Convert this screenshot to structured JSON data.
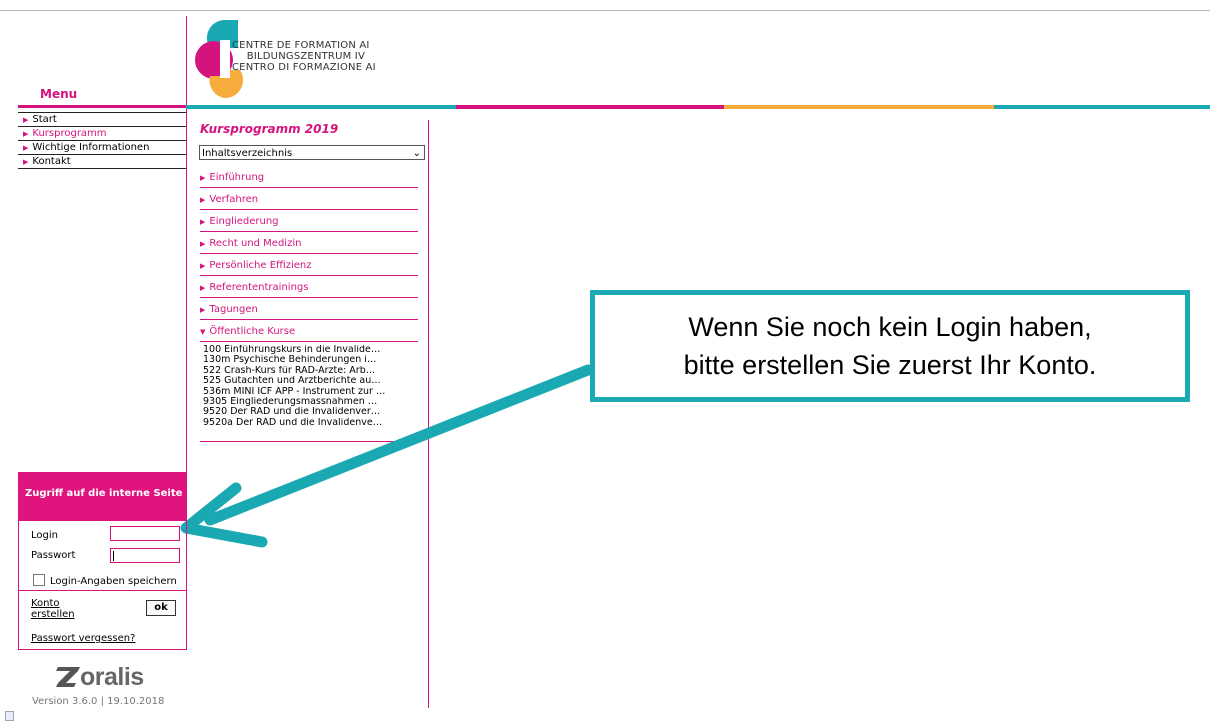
{
  "menu": {
    "title": "Menu",
    "items": [
      {
        "label": "Start"
      },
      {
        "label": "Kursprogramm"
      },
      {
        "label": "Wichtige Informationen"
      },
      {
        "label": "Kontakt"
      }
    ]
  },
  "logo": {
    "lines": [
      "CENTRE DE FORMATION AI",
      "BILDUNGSZENTRUM IV",
      "CENTRO DI FORMAZIONE AI"
    ]
  },
  "colors": {
    "magenta": "#d4137f",
    "teal": "#1aa9b3",
    "orange": "#f6ad3c"
  },
  "kursprogramm": {
    "title": "Kursprogramm 2019",
    "select_value": "Inhaltsverzeichnis",
    "categories": [
      {
        "label": "Einführung"
      },
      {
        "label": "Verfahren"
      },
      {
        "label": "Eingliederung"
      },
      {
        "label": "Recht und Medizin"
      },
      {
        "label": "Persönliche Effizienz"
      },
      {
        "label": "Referententrainings"
      },
      {
        "label": "Tagungen"
      },
      {
        "label": "Öffentliche Kurse"
      }
    ],
    "courses": [
      "100 Einführungskurs in die Invalide…",
      "130m Psychische Behinderungen i…",
      "522 Crash-Kurs für RAD-Ärzte: Arb…",
      "525 Gutachten und Arztberichte au…",
      "536m MINI ICF APP - Instrument zur …",
      "9305 Eingliederungsmassnahmen …",
      "9520 Der RAD und die Invalidenver…",
      "9520a Der RAD und die Invalidenve…"
    ]
  },
  "callout": {
    "line1": "Wenn Sie noch kein Login haben,",
    "line2": "bitte erstellen Sie zuerst Ihr Konto."
  },
  "login": {
    "header": "Zugriff auf die interne Seite",
    "login_label": "Login",
    "login_value": "",
    "password_label": "Passwort",
    "password_value": "",
    "remember_label": "Login-Angaben speichern",
    "create_account": "Konto erstellen",
    "ok_label": "ok",
    "forgot_password": "Passwort vergessen?"
  },
  "footer": {
    "brand": "oralis",
    "version": "Version 3.6.0 | 19.10.2018"
  }
}
